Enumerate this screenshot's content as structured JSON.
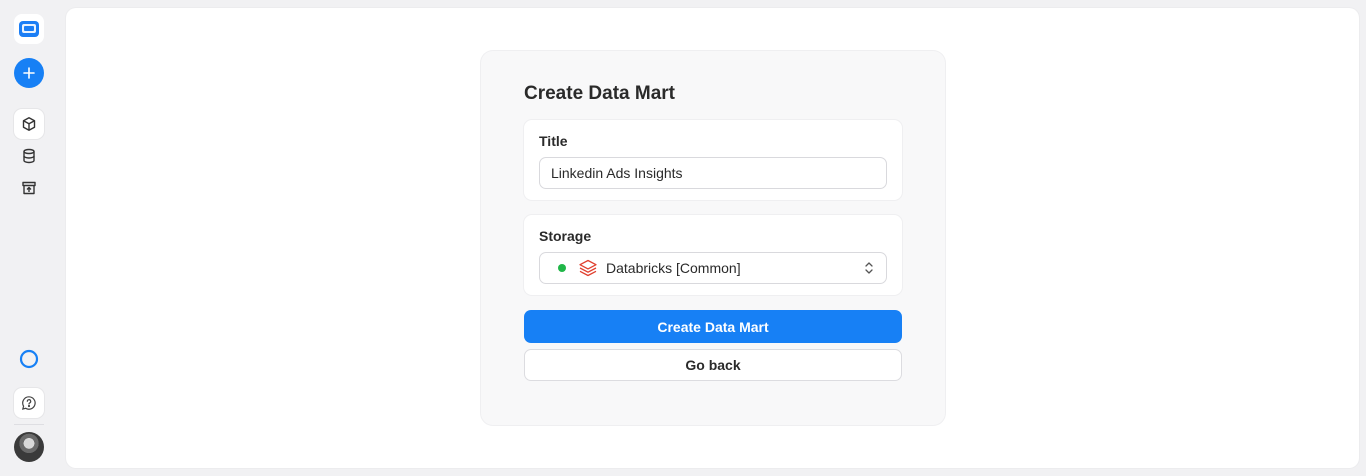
{
  "sidebar": {
    "icons": [
      "app-logo-icon",
      "plus-icon",
      "cube-icon",
      "database-icon",
      "storefront-icon",
      "ring-icon",
      "chat-help-icon",
      "avatar"
    ]
  },
  "form": {
    "title": "Create Data Mart",
    "title_field": {
      "label": "Title",
      "value": "Linkedin Ads Insights"
    },
    "storage_field": {
      "label": "Storage",
      "selected": "Databricks [Common]",
      "status_color": "#20b648"
    },
    "primary_button": "Create Data Mart",
    "secondary_button": "Go back"
  },
  "colors": {
    "accent": "#1780f5",
    "databricks": "#e0402f"
  }
}
